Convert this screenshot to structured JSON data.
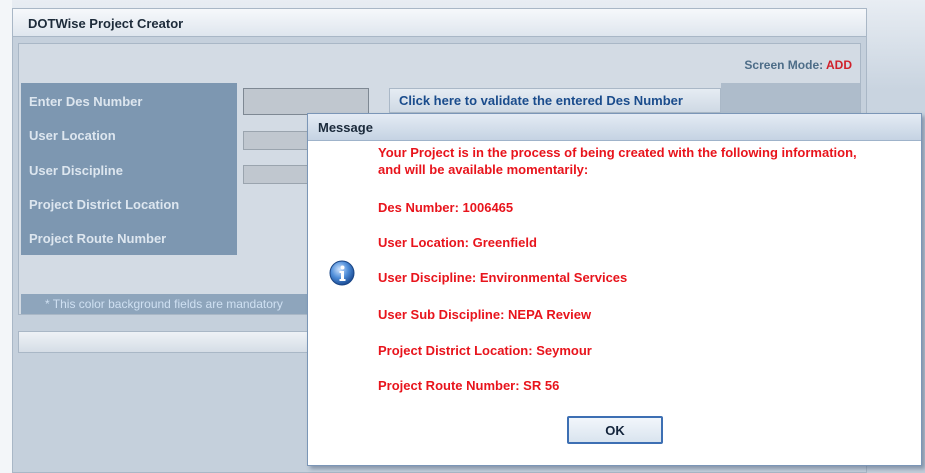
{
  "app": {
    "title": "DOTWise Project Creator",
    "screen_mode_label": "Screen Mode:",
    "screen_mode_value": "ADD"
  },
  "form": {
    "labels": [
      "Enter Des Number",
      "User Location",
      "User Discipline",
      "Project District Location",
      "Project Route Number"
    ],
    "des_number_value": "",
    "validate_button": "Click here to validate the entered Des Number",
    "mandatory_note": "* This color background fields are mandatory"
  },
  "dialog": {
    "title": "Message",
    "intro_line1": "Your Project is in the process of being created with the following information,",
    "intro_line2": "and will be available momentarily:",
    "lines": [
      "Des Number: 1006465",
      "User Location: Greenfield",
      "User Discipline: Environmental Services",
      "User Sub Discipline: NEPA Review",
      "Project District Location: Seymour",
      "Project Route Number: SR 56"
    ],
    "ok_label": "OK",
    "icon": "info-icon"
  },
  "colors": {
    "message_text": "#e8141c",
    "screen_mode_value": "#d0202a",
    "label_column": "#7d97b1"
  }
}
